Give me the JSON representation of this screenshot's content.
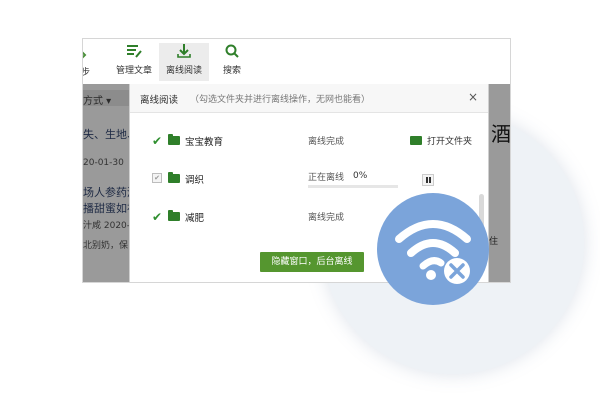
{
  "toolbar": {
    "partial_label": "步",
    "items": [
      {
        "label": "管理文章",
        "icon": "manage-articles-icon"
      },
      {
        "label": "离线阅读",
        "icon": "download-icon"
      },
      {
        "label": "搜索",
        "icon": "search-icon"
      }
    ]
  },
  "left_pane": {
    "sort_label": "方式 ▾",
    "lines": [
      "失、生地、",
      "20-01-30",
      "场人参药酒",
      "播甜蜜如初",
      "汁咸 2020-0",
      "北别奶，保"
    ]
  },
  "right_pane": {
    "big_char": "酒",
    "small_char": "住"
  },
  "dialog": {
    "title": "离线阅读",
    "subtitle": "（勾选文件夹并进行离线操作，无网也能看）",
    "close_symbol": "×",
    "rows": [
      {
        "checked": true,
        "name": "宝宝教育",
        "status": "离线完成",
        "action": "打开文件夹"
      },
      {
        "checked": false,
        "name": "调织",
        "status": "正在离线",
        "percent": "0%",
        "progress": 0
      },
      {
        "checked": true,
        "name": "减肥",
        "status": "离线完成"
      }
    ],
    "hide_button": "隐藏窗口，后台离线"
  },
  "colors": {
    "accent_green": "#55962f",
    "folder_green": "#2f7f2a",
    "badge_blue": "#7ba4da",
    "bg_circle": "#eef2f6"
  },
  "badge_icon": "wifi-off-icon"
}
